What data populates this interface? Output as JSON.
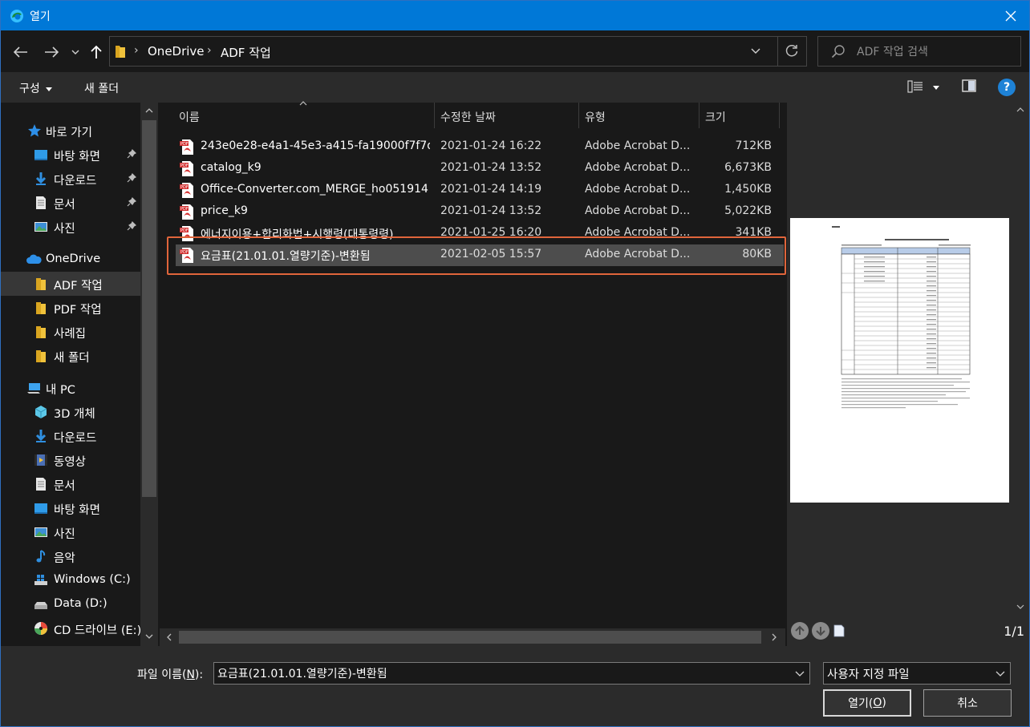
{
  "window": {
    "title": "열기"
  },
  "address": {
    "crumbs": [
      "OneDrive",
      "ADF 작업"
    ]
  },
  "search": {
    "placeholder": "ADF 작업 검색"
  },
  "commands": {
    "organize": "구성",
    "new_folder": "새 폴더"
  },
  "nav": {
    "quick_access": {
      "label": "바로 가기",
      "icon": "star-icon"
    },
    "quick_items": [
      {
        "label": "바탕 화면",
        "icon": "desktop-icon",
        "pinned": true
      },
      {
        "label": "다운로드",
        "icon": "download-icon",
        "pinned": true
      },
      {
        "label": "문서",
        "icon": "document-icon",
        "pinned": true
      },
      {
        "label": "사진",
        "icon": "pictures-icon",
        "pinned": true
      }
    ],
    "onedrive": {
      "label": "OneDrive",
      "icon": "cloud-icon"
    },
    "onedrive_items": [
      {
        "label": "ADF 작업",
        "icon": "folder-icon",
        "selected": true
      },
      {
        "label": "PDF 작업",
        "icon": "folder-icon"
      },
      {
        "label": "사례집",
        "icon": "folder-icon"
      },
      {
        "label": "새 폴더",
        "icon": "folder-icon"
      }
    ],
    "this_pc": {
      "label": "내 PC",
      "icon": "computer-icon"
    },
    "pc_items": [
      {
        "label": "3D 개체",
        "icon": "3d-objects-icon"
      },
      {
        "label": "다운로드",
        "icon": "download-icon"
      },
      {
        "label": "동영상",
        "icon": "video-icon"
      },
      {
        "label": "문서",
        "icon": "document-icon"
      },
      {
        "label": "바탕 화면",
        "icon": "desktop-icon"
      },
      {
        "label": "사진",
        "icon": "pictures-icon"
      },
      {
        "label": "음악",
        "icon": "music-icon"
      },
      {
        "label": "Windows (C:)",
        "icon": "windows-drive-icon"
      },
      {
        "label": "Data (D:)",
        "icon": "drive-icon"
      },
      {
        "label": "CD 드라이브 (E:)",
        "icon": "cd-drive-icon"
      }
    ]
  },
  "columns": {
    "name": "이름",
    "date": "수정한 날짜",
    "type": "유형",
    "size": "크기"
  },
  "files": [
    {
      "name": "243e0e28-e4a1-45e3-a415-fa19000f7f7d...",
      "date": "2021-01-24 16:22",
      "type": "Adobe Acrobat D...",
      "size": "712KB"
    },
    {
      "name": "catalog_k9",
      "date": "2021-01-24 13:52",
      "type": "Adobe Acrobat D...",
      "size": "6,673KB"
    },
    {
      "name": "Office-Converter.com_MERGE_ho051914",
      "date": "2021-01-24 14:19",
      "type": "Adobe Acrobat D...",
      "size": "1,450KB"
    },
    {
      "name": "price_k9",
      "date": "2021-01-24 13:52",
      "type": "Adobe Acrobat D...",
      "size": "5,022KB"
    },
    {
      "name": "에너지이용+합리화법+시행령(대통령령)...",
      "date": "2021-01-25 16:20",
      "type": "Adobe Acrobat D...",
      "size": "341KB"
    },
    {
      "name": "요금표(21.01.01.열량기준)-변환됨",
      "date": "2021-02-05 15:57",
      "type": "Adobe Acrobat D...",
      "size": "80KB",
      "selected": true
    }
  ],
  "preview": {
    "page_indicator": "1/1"
  },
  "bottom": {
    "filename_label_prefix": "파일 이름(",
    "filename_label_key": "N",
    "filename_label_suffix": "):",
    "filename_value": "요금표(21.01.01.열량기준)-변환됨",
    "filetype_value": "사용자 지정 파일",
    "open_prefix": "열기(",
    "open_key": "O",
    "open_suffix": ")",
    "cancel": "취소"
  },
  "colors": {
    "accent": "#0078d7",
    "highlight_border": "#e0653b",
    "selected_row": "#4d4d4d"
  }
}
